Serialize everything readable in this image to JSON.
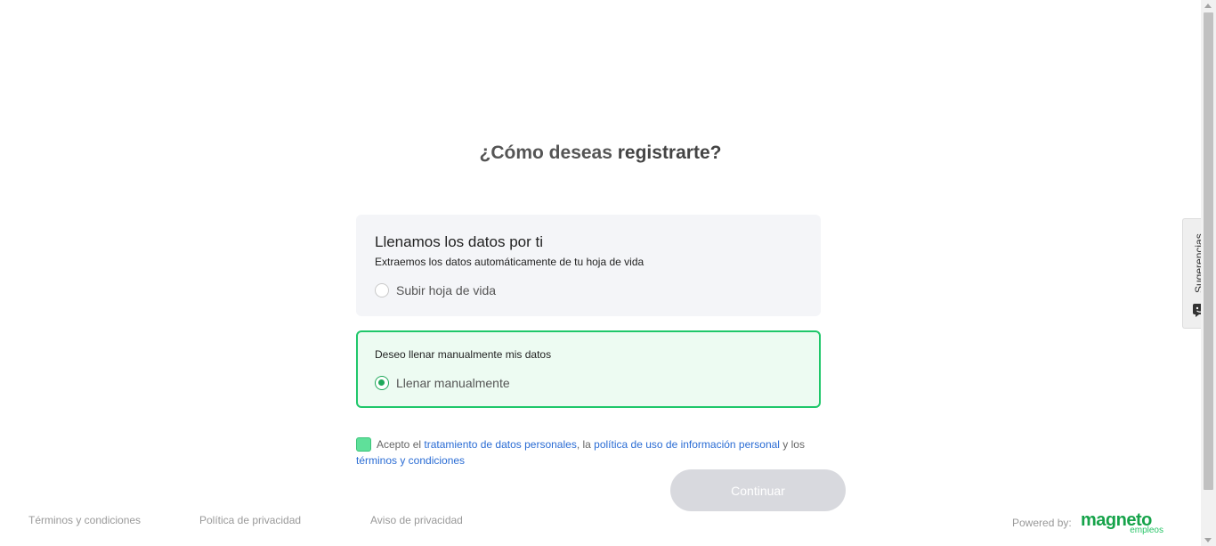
{
  "heading": {
    "prefix": "¿Cómo deseas ",
    "bold": "registrarte?"
  },
  "option_auto": {
    "title": "Llenamos los datos por ti",
    "subtitle": "Extraemos los datos automáticamente de tu hoja de vida",
    "radio_label": "Subir hoja de vida",
    "selected": false
  },
  "option_manual": {
    "subtitle": "Deseo llenar manualmente mis datos",
    "radio_label": "Llenar manualmente",
    "selected": true
  },
  "consent": {
    "checked": true,
    "text_1": "Acepto el ",
    "link_1": "tratamiento de datos personales",
    "text_2": ", la ",
    "link_2": "política de uso de información personal",
    "text_3": " y los ",
    "link_3": "términos y condiciones"
  },
  "continue_button": "Continuar",
  "footer": {
    "terms": "Términos y condiciones",
    "privacy_policy": "Política de privacidad",
    "privacy_notice": "Aviso de privacidad",
    "powered_by": "Powered by:",
    "logo_main": "magneto",
    "logo_sub": "empleos"
  },
  "feedback_tab": {
    "label": "Sugerencias",
    "icon": "chat-face-icon"
  },
  "colors": {
    "accent_green": "#1fc76a",
    "link_blue": "#2a6cd4",
    "button_disabled": "#d8d9de"
  }
}
